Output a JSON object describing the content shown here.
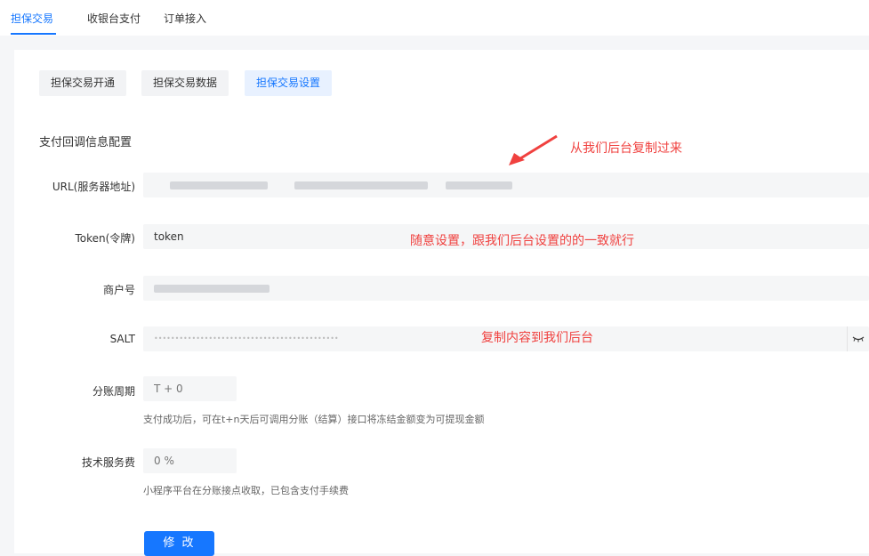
{
  "top_tabs": [
    {
      "label": "担保交易",
      "active": true
    },
    {
      "label": "收银台支付",
      "active": false
    },
    {
      "label": "订单接入",
      "active": false
    }
  ],
  "sub_tabs": [
    {
      "label": "担保交易开通",
      "active": false
    },
    {
      "label": "担保交易数据",
      "active": false
    },
    {
      "label": "担保交易设置",
      "active": true
    }
  ],
  "section_title": "支付回调信息配置",
  "form": {
    "url_label": "URL(服务器地址)",
    "token_label": "Token(令牌)",
    "token_value": "token",
    "merchant_label": "商户号",
    "salt_label": "SALT",
    "salt_value": "••••••••••••••••••••••••••••••••••••••••••••",
    "cycle_label": "分账周期",
    "cycle_placeholder": "T + 0",
    "cycle_hint": "支付成功后，可在t+n天后可调用分账（结算）接口将冻结金额变为可提现金额",
    "fee_label": "技术服务费",
    "fee_placeholder": "0 %",
    "fee_hint": "小程序平台在分账接点收取，已包含支付手续费",
    "submit_label": "修 改"
  },
  "annotations": {
    "url_note": "从我们后台复制过来",
    "token_note": "随意设置，跟我们后台设置的的一致就行",
    "salt_note": "复制内容到我们后台"
  },
  "colors": {
    "accent": "#1677ff",
    "annotation": "#f0413f"
  },
  "icons": {
    "salt_toggle": "eye-closed-icon"
  }
}
